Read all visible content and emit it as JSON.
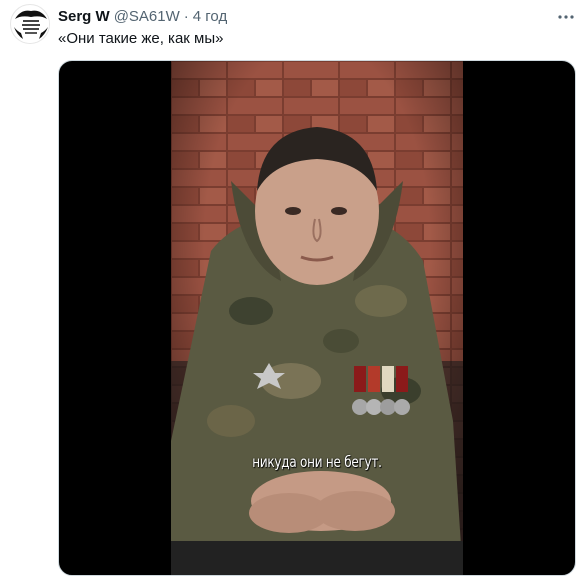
{
  "tweet": {
    "display_name": "Serg W",
    "handle": "@SA61W",
    "separator": "·",
    "time": "4 год",
    "text": "«Они такие же, как мы»"
  },
  "media": {
    "subtitle": "никуда они не бегут."
  },
  "icons": {
    "more": "more-horizontal-icon",
    "avatar": "avatar-image"
  },
  "colors": {
    "text_primary": "#0f1419",
    "text_secondary": "#536471",
    "media_background": "#000000"
  }
}
